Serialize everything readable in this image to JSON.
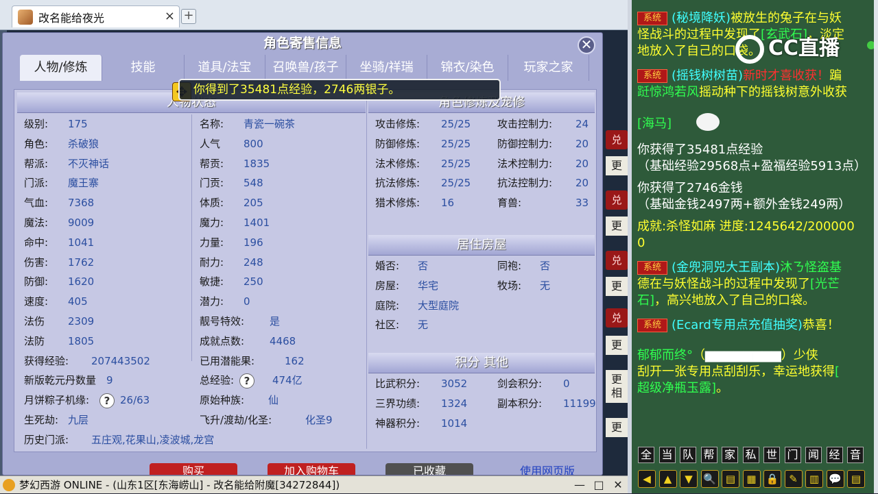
{
  "browser": {
    "tab_title": "改名能给夜光",
    "new_tab": "+"
  },
  "dialog": {
    "title": "角色寄售信息",
    "close": "✕",
    "tabs": [
      "人物/修炼",
      "技能",
      "道具/法宝",
      "召唤兽/孩子",
      "坐骑/祥瑞",
      "锦衣/染色",
      "玩家之家"
    ],
    "panels": {
      "status": "人物状态",
      "cultivation": "角色修炼及宠修",
      "house": "居住房屋",
      "points": "积分 其他"
    },
    "left_col1": [
      {
        "label": "级别:",
        "value": "175"
      },
      {
        "label": "角色:",
        "value": "杀破狼"
      },
      {
        "label": "帮派:",
        "value": "不灭神话"
      },
      {
        "label": "门派:",
        "value": "魔王寨"
      },
      {
        "label": "气血:",
        "value": "7368"
      },
      {
        "label": "魔法:",
        "value": "9009"
      },
      {
        "label": "命中:",
        "value": "1041"
      },
      {
        "label": "伤害:",
        "value": "1762"
      },
      {
        "label": "防御:",
        "value": "1620"
      },
      {
        "label": "速度:",
        "value": "405"
      },
      {
        "label": "法伤",
        "value": "2309"
      },
      {
        "label": "法防",
        "value": "1805"
      }
    ],
    "left_col2": [
      {
        "label": "名称:",
        "value": "青瓷一碗茶"
      },
      {
        "label": "人气",
        "value": "800"
      },
      {
        "label": "帮贡:",
        "value": "1835"
      },
      {
        "label": "门贡:",
        "value": "548"
      },
      {
        "label": "体质:",
        "value": "205"
      },
      {
        "label": "魔力:",
        "value": "1401"
      },
      {
        "label": "力量:",
        "value": "196"
      },
      {
        "label": "耐力:",
        "value": "248"
      },
      {
        "label": "敏捷:",
        "value": "250"
      },
      {
        "label": "潜力:",
        "value": "0"
      },
      {
        "label": "靓号特效:",
        "value": "是"
      },
      {
        "label": "成就点数:",
        "value": "4468"
      }
    ],
    "left_wide": [
      {
        "label": "获得经验:",
        "value": "207443502"
      },
      {
        "label": "新版乾元丹数量",
        "value": "9"
      },
      {
        "label": "月饼粽子机缘:",
        "value": "26/63"
      },
      {
        "label": "生死劫:",
        "value": "九层"
      },
      {
        "label": "历史门派:",
        "value": "五庄观,花果山,凌波城,龙宫"
      }
    ],
    "left_wide2": [
      {
        "label": "已用潜能果:",
        "value": "162"
      },
      {
        "label": "总经验:",
        "value": "474亿"
      },
      {
        "label": "原始种族:",
        "value": "仙"
      },
      {
        "label": "飞升/渡劫/化圣:",
        "value": "化圣9"
      }
    ],
    "cult_a": [
      {
        "label": "攻击修炼:",
        "value": "25/25"
      },
      {
        "label": "防御修炼:",
        "value": "25/25"
      },
      {
        "label": "法术修炼:",
        "value": "25/25"
      },
      {
        "label": "抗法修炼:",
        "value": "25/25"
      },
      {
        "label": "猎术修炼:",
        "value": "16"
      }
    ],
    "cult_b": [
      {
        "label": "攻击控制力:",
        "value": "24"
      },
      {
        "label": "防御控制力:",
        "value": "20"
      },
      {
        "label": "法术控制力:",
        "value": "20"
      },
      {
        "label": "抗法控制力:",
        "value": "20"
      },
      {
        "label": "育兽:",
        "value": "33"
      }
    ],
    "house_a": [
      {
        "label": "婚否:",
        "value": "否"
      },
      {
        "label": "房屋:",
        "value": "华宅"
      },
      {
        "label": "庭院:",
        "value": "大型庭院"
      },
      {
        "label": "社区:",
        "value": "无"
      }
    ],
    "house_b": [
      {
        "label": "同袍:",
        "value": "否"
      },
      {
        "label": "牧场:",
        "value": "无"
      }
    ],
    "points_a": [
      {
        "label": "比武积分:",
        "value": "3052"
      },
      {
        "label": "三界功绩:",
        "value": "1324"
      },
      {
        "label": "神器积分:",
        "value": "1014"
      }
    ],
    "points_b": [
      {
        "label": "剑会积分:",
        "value": "0"
      },
      {
        "label": "副本积分:",
        "value": "11199"
      }
    ],
    "qmark": "?",
    "bottom_buttons": [
      "购买",
      "加入购物车",
      "已收藏",
      "使用网页版"
    ]
  },
  "notify": {
    "text": "你得到了35481点经验，2746两银子。",
    "icon": "✥"
  },
  "statusbar": {
    "text": "梦幻西游 ONLINE - (山东1区[东海崂山] - 改名能给附魔[34272844])",
    "min": "—",
    "max": "□",
    "close": "✕"
  },
  "side_bg": [
    "兑",
    "更",
    "兑",
    "更",
    "兑",
    "更",
    "兑",
    "更",
    "更",
    "相",
    "更"
  ],
  "chat": {
    "sys_tag": "系统",
    "lines": [
      {
        "parts": [
          {
            "t": "(秘境降妖)",
            "c": "c-cyan"
          },
          {
            "t": "被放生的兔子在与妖",
            "c": "c-yellow"
          }
        ],
        "tag": true
      },
      {
        "parts": [
          {
            "t": "怪战斗的过程中发现了",
            "c": "c-yellow"
          },
          {
            "t": "[玄武石]",
            "c": "c-green"
          },
          {
            "t": "，淡定",
            "c": "c-yellow"
          }
        ]
      },
      {
        "parts": [
          {
            "t": "地放入了自己的口袋。",
            "c": "c-yellow"
          }
        ]
      },
      {
        "parts": [
          {
            "t": "(摇钱树树苗)",
            "c": "c-cyan"
          },
          {
            "t": "新时才喜收获！",
            "c": "c-red"
          },
          {
            "t": "蹁",
            "c": "c-yellow"
          }
        ],
        "tag": true
      },
      {
        "parts": [
          {
            "t": "跹惊鸿若风",
            "c": "c-green"
          },
          {
            "t": "摇动种下的摇钱树意外收获",
            "c": "c-yellow"
          }
        ]
      },
      {
        "parts": [
          {
            "t": "[海马]",
            "c": "c-green"
          }
        ]
      },
      {
        "parts": [
          {
            "t": "你获得了35481点经验",
            "c": "c-white"
          }
        ]
      },
      {
        "parts": [
          {
            "t": "（基础经验29568点+盈福经验5913点）",
            "c": "c-white"
          }
        ]
      },
      {
        "parts": [
          {
            "t": "你获得了2746金钱",
            "c": "c-white"
          }
        ]
      },
      {
        "parts": [
          {
            "t": "（基础金钱2497两+额外金钱249两）",
            "c": "c-white"
          }
        ]
      },
      {
        "parts": [
          {
            "t": "成就:杀怪如麻  进度:1245642/200000",
            "c": "c-yellow"
          }
        ]
      },
      {
        "parts": [
          {
            "t": "0",
            "c": "c-yellow"
          }
        ]
      },
      {
        "parts": [
          {
            "t": "(金兜洞兕大王副本)",
            "c": "c-cyan"
          },
          {
            "t": "沐ㄋ怪盗基",
            "c": "c-green"
          }
        ],
        "tag": true
      },
      {
        "parts": [
          {
            "t": "德在与妖怪战斗的过程中发现了",
            "c": "c-yellow"
          },
          {
            "t": "[光芒",
            "c": "c-green"
          }
        ]
      },
      {
        "parts": [
          {
            "t": "石]",
            "c": "c-green"
          },
          {
            "t": "，高兴地放入了自己的口袋。",
            "c": "c-yellow"
          }
        ]
      },
      {
        "parts": [
          {
            "t": "(Ecard专用点充值抽奖)",
            "c": "c-cyan"
          },
          {
            "t": "恭喜！",
            "c": "c-yellow"
          }
        ],
        "tag": true
      },
      {
        "parts": [
          {
            "t": "郁郁而终°",
            "c": "c-green"
          },
          {
            "t": "（",
            "c": "c-yellow"
          },
          {
            "t": "▆▆▆▆▆▆▆▆",
            "c": "c-white"
          },
          {
            "t": "）少侠",
            "c": "c-yellow"
          }
        ]
      },
      {
        "parts": [
          {
            "t": "刮开一张专用点刮刮乐，幸运地获得",
            "c": "c-yellow"
          },
          {
            "t": "[",
            "c": "c-green"
          }
        ]
      },
      {
        "parts": [
          {
            "t": "超级净瓶玉露]",
            "c": "c-green"
          },
          {
            "t": "。",
            "c": "c-yellow"
          }
        ]
      }
    ],
    "toolbar1": [
      "全",
      "当",
      "队",
      "帮",
      "家",
      "私",
      "世",
      "门",
      "闻",
      "经",
      "音"
    ],
    "toolbar2": [
      "◀",
      "▲",
      "▼",
      "🔍",
      "▤",
      "▦",
      "🔒",
      "✎",
      "▥",
      "💬",
      "▤"
    ],
    "watermark": "CC直播"
  }
}
